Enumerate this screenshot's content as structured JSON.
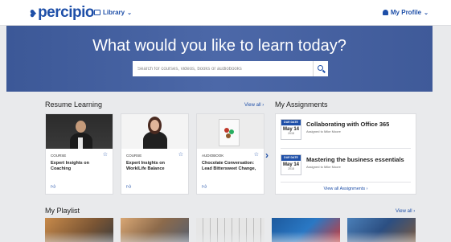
{
  "header": {
    "logo_mark": "❥",
    "logo_text": "percipio",
    "library_label": "Library",
    "profile_label": "My Profile"
  },
  "hero": {
    "title": "What would you like to learn today?",
    "search_placeholder": "Search for courses, videos, books or audiobooks"
  },
  "resume": {
    "title": "Resume Learning",
    "view_all": "View all ›",
    "cards": [
      {
        "type": "COURSE",
        "title": "Expert Insights on Coaching"
      },
      {
        "type": "COURSE",
        "title": "Expert Insights on Work/Life Balance"
      },
      {
        "type": "AUDIOBOOK",
        "title": "Chocolate Conversation: Lead Bittersweet Change,"
      }
    ]
  },
  "assignments": {
    "title": "My Assignments",
    "items": [
      {
        "due_label": "DUE DATE",
        "month_day": "May 14",
        "year": "2018",
        "title": "Collaborating with Office 365",
        "assigned_by": "Assigned to Mike Moore"
      },
      {
        "due_label": "DUE DATE",
        "month_day": "May 14",
        "year": "2018",
        "title": "Mastering the business essentials",
        "assigned_by": "Assigned to Mike Moore"
      }
    ],
    "view_all": "View all Assignments ›"
  },
  "playlist": {
    "title": "My Playlist",
    "view_all": "View all ›"
  },
  "colors": {
    "brand": "#1e4fa8",
    "hero_bg": "#4c68a8",
    "page_bg": "#e9eaec"
  }
}
